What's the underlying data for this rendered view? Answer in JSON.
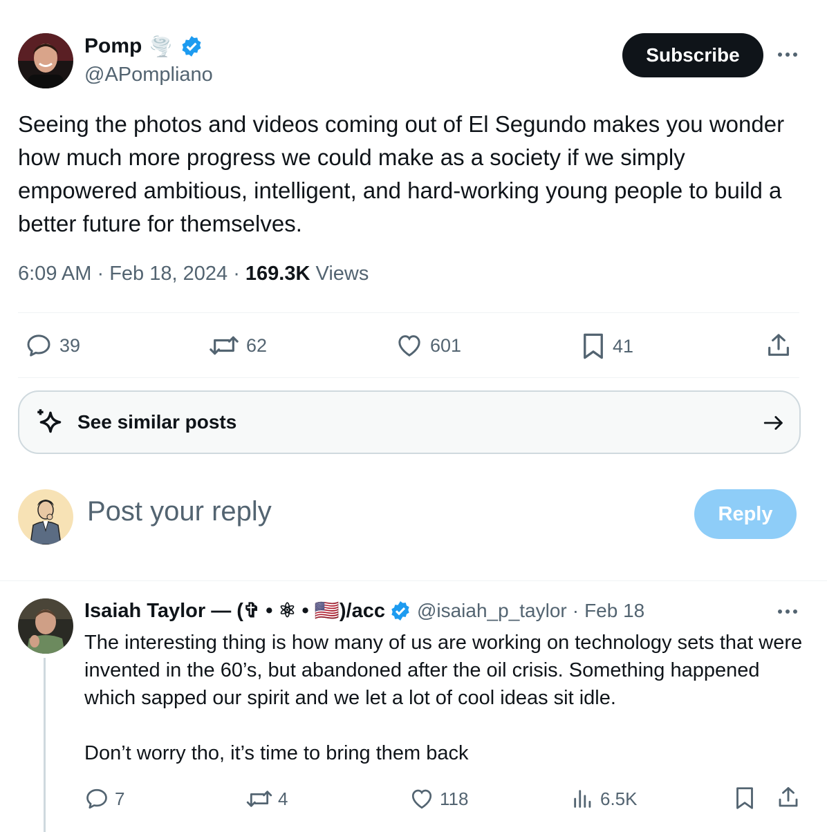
{
  "main_tweet": {
    "author_name": "Pomp",
    "author_emoji": "🌪️",
    "handle": "@APompliano",
    "subscribe_label": "Subscribe",
    "text": "Seeing the photos and videos coming out of El Segundo makes you wonder how much more progress we could make as a society if we simply empowered ambitious, intelligent, and hard-working young people to build a better future for themselves.",
    "time": "6:09 AM",
    "date": "Feb 18, 2024",
    "views_count": "169.3K",
    "views_label": "Views",
    "separator": "·",
    "stats": {
      "replies": "39",
      "reposts": "62",
      "likes": "601",
      "bookmarks": "41"
    }
  },
  "similar_posts": {
    "label": "See similar posts"
  },
  "composer": {
    "placeholder": "Post your reply",
    "reply_label": "Reply"
  },
  "reply_tweet": {
    "author_name": "Isaiah Taylor — (✞ • ⚛ • 🇺🇸)/acc",
    "handle": "@isaiah_p_taylor",
    "separator": "·",
    "date": "Feb 18",
    "paragraph1": "The interesting thing is how many of us are working on technology sets that were invented in the 60’s, but abandoned after the oil crisis. Something happened which sapped our spirit and we let a lot of cool ideas sit idle.",
    "paragraph2": "Don’t worry tho, it’s time to bring them back",
    "stats": {
      "replies": "7",
      "reposts": "4",
      "likes": "118",
      "views": "6.5K"
    }
  },
  "colors": {
    "text": "#0f1419",
    "secondary": "#536471",
    "verified": "#1d9bf0",
    "reply_button": "#8ecdf8",
    "subscribe_bg": "#0f1419"
  }
}
